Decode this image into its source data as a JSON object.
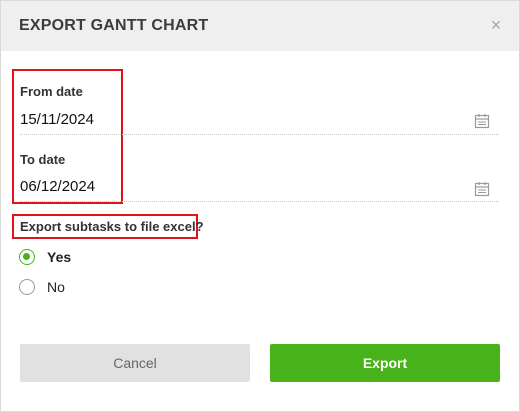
{
  "dialog": {
    "title": "EXPORT GANTT CHART",
    "close_icon": "close-icon",
    "close_glyph": "×"
  },
  "from_date": {
    "label": "From date",
    "value": "15/11/2024",
    "icon": "calendar-icon"
  },
  "to_date": {
    "label": "To date",
    "value": "06/12/2024",
    "icon": "calendar-icon"
  },
  "subtasks": {
    "question": "Export subtasks to file excel?",
    "options": [
      {
        "label": "Yes",
        "selected": true
      },
      {
        "label": "No",
        "selected": false
      }
    ]
  },
  "actions": {
    "cancel_label": "Cancel",
    "export_label": "Export"
  },
  "colors": {
    "accent_green": "#47b21a",
    "highlight_red": "#e0131a",
    "header_bg": "#efefef",
    "cancel_bg": "#e1e1e1"
  }
}
